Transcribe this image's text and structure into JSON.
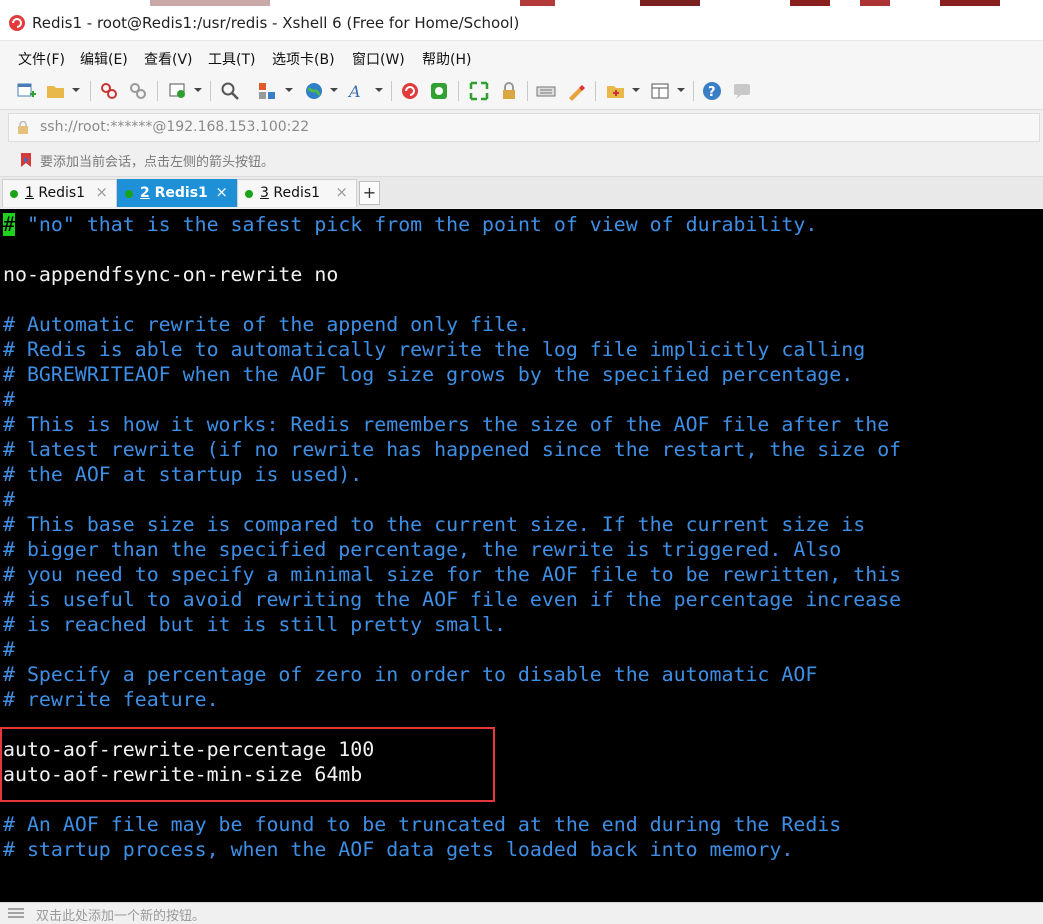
{
  "window": {
    "title": "Redis1 - root@Redis1:/usr/redis - Xshell 6 (Free for Home/School)"
  },
  "menubar": {
    "items": [
      "文件(F)",
      "编辑(E)",
      "查看(V)",
      "工具(T)",
      "选项卡(B)",
      "窗口(W)",
      "帮助(H)"
    ]
  },
  "toolbar": {
    "icons": [
      "new-session-icon",
      "open-folder-icon",
      "disconnect-icon",
      "reconnect-icon",
      "properties-icon",
      "find-icon",
      "transfer-icon",
      "globe-icon",
      "font-icon",
      "xshell-icon",
      "xftp-icon",
      "fullscreen-icon",
      "lock-icon",
      "keyboard-icon",
      "highlight-icon",
      "new-folder-icon",
      "layout-icon",
      "help-icon",
      "chat-icon"
    ]
  },
  "address": {
    "value": "ssh://root:******@192.168.153.100:22"
  },
  "hint": {
    "text": "要添加当前会话，点击左侧的箭头按钮。"
  },
  "tabs": [
    {
      "num": "1",
      "label": " Redis1",
      "active": false
    },
    {
      "num": "2",
      "label": " Redis1",
      "active": true
    },
    {
      "num": "3",
      "label": " Redis1",
      "active": false
    }
  ],
  "terminal": {
    "lines": [
      {
        "text": " \"no\" that is the safest pick from the point of view of durability.",
        "kind": "comment",
        "cursor_prefix": "#"
      },
      {
        "text": "",
        "kind": "text"
      },
      {
        "text": "no-appendfsync-on-rewrite no",
        "kind": "text"
      },
      {
        "text": "",
        "kind": "text"
      },
      {
        "text": "# Automatic rewrite of the append only file.",
        "kind": "comment"
      },
      {
        "text": "# Redis is able to automatically rewrite the log file implicitly calling",
        "kind": "comment"
      },
      {
        "text": "# BGREWRITEAOF when the AOF log size grows by the specified percentage.",
        "kind": "comment"
      },
      {
        "text": "#",
        "kind": "comment"
      },
      {
        "text": "# This is how it works: Redis remembers the size of the AOF file after the",
        "kind": "comment"
      },
      {
        "text": "# latest rewrite (if no rewrite has happened since the restart, the size of",
        "kind": "comment"
      },
      {
        "text": "# the AOF at startup is used).",
        "kind": "comment"
      },
      {
        "text": "#",
        "kind": "comment"
      },
      {
        "text": "# This base size is compared to the current size. If the current size is",
        "kind": "comment"
      },
      {
        "text": "# bigger than the specified percentage, the rewrite is triggered. Also",
        "kind": "comment"
      },
      {
        "text": "# you need to specify a minimal size for the AOF file to be rewritten, this",
        "kind": "comment"
      },
      {
        "text": "# is useful to avoid rewriting the AOF file even if the percentage increase",
        "kind": "comment"
      },
      {
        "text": "# is reached but it is still pretty small.",
        "kind": "comment"
      },
      {
        "text": "#",
        "kind": "comment"
      },
      {
        "text": "# Specify a percentage of zero in order to disable the automatic AOF",
        "kind": "comment"
      },
      {
        "text": "# rewrite feature.",
        "kind": "comment"
      },
      {
        "text": "",
        "kind": "text"
      },
      {
        "text": "auto-aof-rewrite-percentage 100",
        "kind": "text"
      },
      {
        "text": "auto-aof-rewrite-min-size 64mb",
        "kind": "text"
      },
      {
        "text": "",
        "kind": "text"
      },
      {
        "text": "# An AOF file may be found to be truncated at the end during the Redis",
        "kind": "comment"
      },
      {
        "text": "# startup process, when the AOF data gets loaded back into memory.",
        "kind": "comment"
      }
    ],
    "colors": {
      "background": "#000000",
      "comment": "#3e8fe6",
      "text": "#f2f2f2",
      "cursor": "#1fd21f",
      "highlight_box": "#e8373b"
    }
  },
  "statusbar": {
    "text": "双击此处添加一个新的按钮。"
  }
}
